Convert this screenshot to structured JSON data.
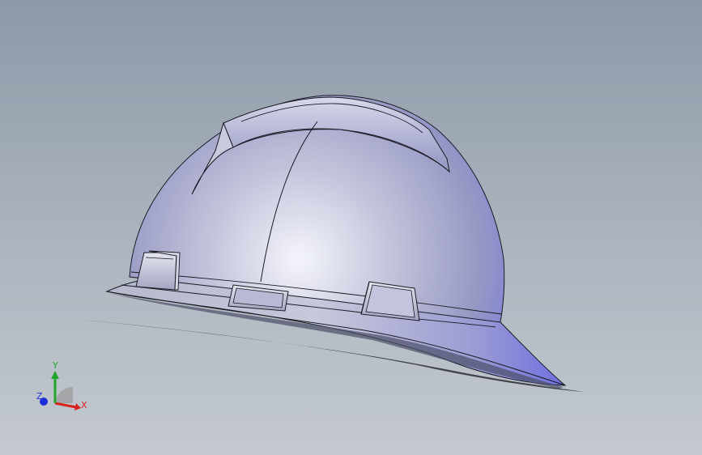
{
  "viewport": {
    "background_top": "#8d99a8",
    "background_bottom": "#c4c9cf"
  },
  "model": {
    "shell_light": "#dfe2f2",
    "shell_mid": "#a9aac9",
    "shell_blue": "#6f6fe8",
    "edge_color": "#1a1a24"
  },
  "triad": {
    "x_label": "X",
    "y_label": "Y",
    "z_label": "Z",
    "x_color": "#d9221c",
    "y_color": "#22a52a",
    "z_color": "#1e2ed8"
  }
}
